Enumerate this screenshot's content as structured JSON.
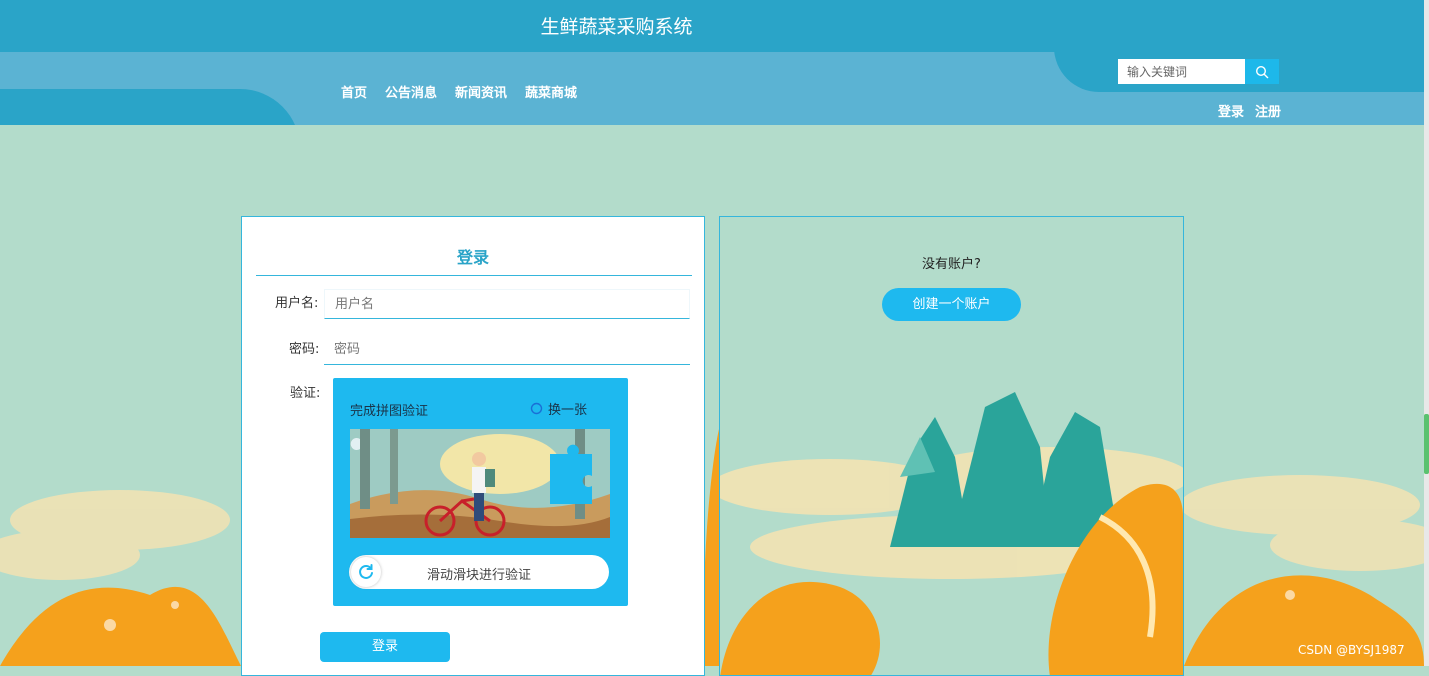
{
  "header": {
    "site_title": "生鲜蔬菜采购系统",
    "nav_items": [
      "首页",
      "公告消息",
      "新闻资讯",
      "蔬菜商城"
    ],
    "search": {
      "placeholder": "输入关键词",
      "value": ""
    },
    "auth_links": [
      "登录",
      "注册"
    ]
  },
  "login": {
    "title": "登录",
    "username_label": "用户名:",
    "username_placeholder": "用户名",
    "password_label": "密码:",
    "password_placeholder": "密码",
    "captcha_label": "验证:",
    "captcha": {
      "title": "完成拼图验证",
      "refresh_label": "换一张",
      "slider_hint": "滑动滑块进行验证"
    },
    "submit_label": "登录"
  },
  "register": {
    "prompt": "没有账户?",
    "create_label": "创建一个账户"
  },
  "watermark": "CSDN @BYSJ1987",
  "colors": {
    "header_dark": "#2aa4c8",
    "header_light": "#5bb3d3",
    "accent": "#1eb9ef",
    "page_bg": "#b3dccb",
    "orange": "#f5a11c"
  },
  "icons": {
    "search_button": "search-icon",
    "captcha_refresh": "refresh-icon",
    "slider_handle": "refresh-arrow-icon"
  }
}
